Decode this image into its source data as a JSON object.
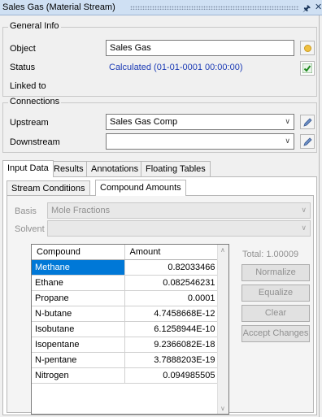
{
  "title": "Sales Gas (Material Stream)",
  "general_info": {
    "legend": "General Info",
    "object_label": "Object",
    "object_value": "Sales Gas",
    "status_label": "Status",
    "status_value": "Calculated (01-01-0001 00:00:00)",
    "linked_label": "Linked to"
  },
  "connections": {
    "legend": "Connections",
    "upstream_label": "Upstream",
    "upstream_value": "Sales Gas Comp",
    "downstream_label": "Downstream",
    "downstream_value": ""
  },
  "tabs": [
    "Input Data",
    "Results",
    "Annotations",
    "Floating Tables"
  ],
  "subtabs": [
    "Stream Conditions",
    "Compound Amounts"
  ],
  "basis": {
    "label": "Basis",
    "value": "Mole Fractions"
  },
  "solvent": {
    "label": "Solvent",
    "value": ""
  },
  "grid": {
    "headers": [
      "Compound",
      "Amount"
    ],
    "rows": [
      {
        "compound": "Methane",
        "amount": "0.82033466"
      },
      {
        "compound": "Ethane",
        "amount": "0.082546231"
      },
      {
        "compound": "Propane",
        "amount": "0.0001"
      },
      {
        "compound": "N-butane",
        "amount": "4.7458668E-12"
      },
      {
        "compound": "Isobutane",
        "amount": "6.1258944E-10"
      },
      {
        "compound": "Isopentane",
        "amount": "9.2366082E-18"
      },
      {
        "compound": "N-pentane",
        "amount": "3.7888203E-19"
      },
      {
        "compound": "Nitrogen",
        "amount": "0.094985505"
      }
    ]
  },
  "total_text": "Total: 1.00009",
  "buttons": {
    "normalize": "Normalize",
    "equalize": "Equalize",
    "clear": "Clear",
    "accept": "Accept Changes"
  },
  "colors": {
    "selection": "#0078d7",
    "status_text": "#1a3ab5",
    "status_ok": "#3a9a3a"
  }
}
